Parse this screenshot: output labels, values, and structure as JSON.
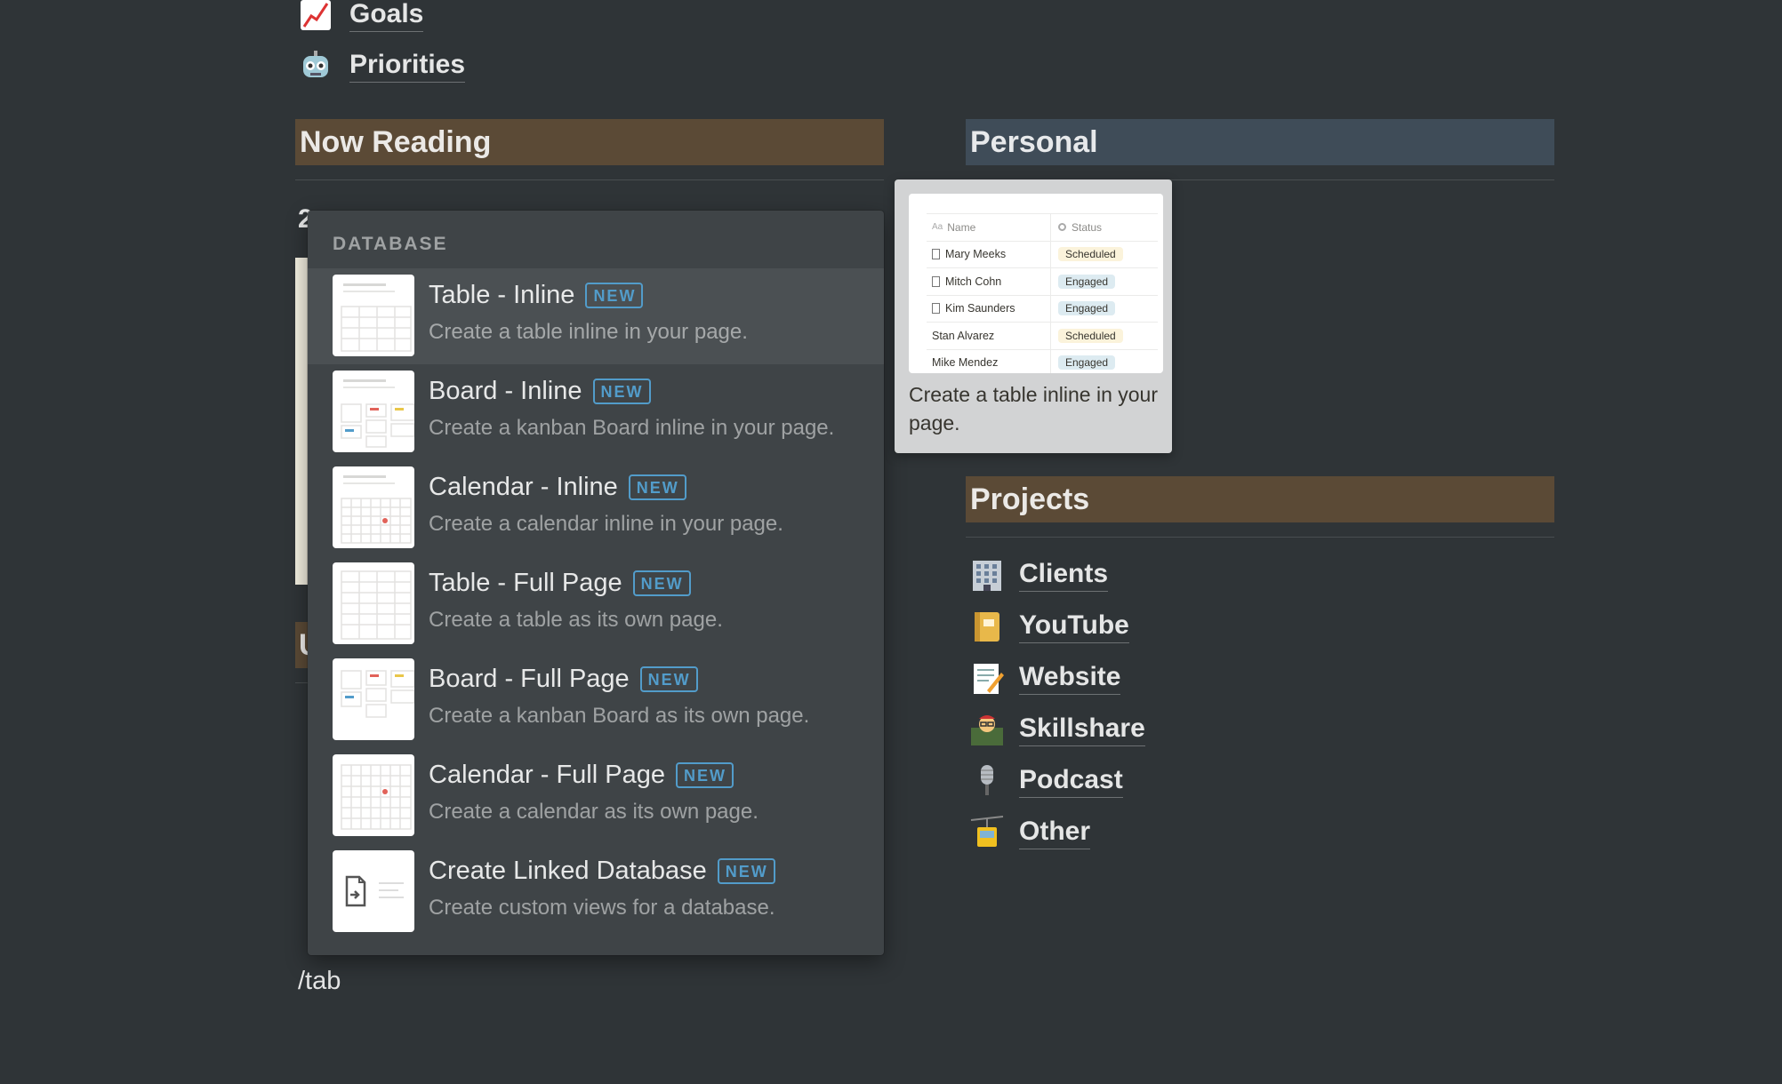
{
  "top_links": [
    {
      "label": "Goals",
      "icon": "chart-increasing-icon"
    },
    {
      "label": "Priorities",
      "icon": "robot-icon"
    }
  ],
  "sections": {
    "now_reading": {
      "title": "Now Reading",
      "color": "#5b4a36"
    },
    "personal": {
      "title": "Personal",
      "color": "#3f4c58"
    },
    "projects": {
      "title": "Projects",
      "color": "#5b4a36"
    }
  },
  "hidden_fragments": {
    "now_reading_first_char": "2",
    "next_header_first_char": "U"
  },
  "menu": {
    "heading": "DATABASE",
    "badge": "NEW",
    "badge_color": "#529cca",
    "items": [
      {
        "title": "Table - Inline",
        "desc": "Create a table inline in your page.",
        "icon": "table-thumbnail"
      },
      {
        "title": "Board - Inline",
        "desc": "Create a kanban Board inline in your page.",
        "icon": "board-thumbnail"
      },
      {
        "title": "Calendar - Inline",
        "desc": "Create a calendar inline in your page.",
        "icon": "calendar-thumbnail"
      },
      {
        "title": "Table - Full Page",
        "desc": "Create a table as its own page.",
        "icon": "table-full-thumbnail"
      },
      {
        "title": "Board - Full Page",
        "desc": "Create a kanban Board as its own page.",
        "icon": "board-full-thumbnail"
      },
      {
        "title": "Calendar - Full Page",
        "desc": "Create a calendar as its own page.",
        "icon": "calendar-full-thumbnail"
      },
      {
        "title": "Create Linked Database",
        "desc": "Create custom views for a database.",
        "icon": "linked-database-thumbnail"
      }
    ]
  },
  "preview": {
    "col_name": "Name",
    "col_status": "Status",
    "rows": [
      {
        "name": "Mary Meeks",
        "status": "Scheduled",
        "has_icon": true
      },
      {
        "name": "Mitch Cohn",
        "status": "Engaged",
        "has_icon": true
      },
      {
        "name": "Kim Saunders",
        "status": "Engaged",
        "has_icon": true
      },
      {
        "name": "Stan Alvarez",
        "status": "Scheduled",
        "has_icon": false
      },
      {
        "name": "Mike Mendez",
        "status": "Engaged",
        "has_icon": false
      }
    ],
    "status_colors": {
      "Scheduled": "#fbf3db",
      "Engaged": "#ddebf1"
    },
    "description": "Create a table inline in your page."
  },
  "projects": [
    {
      "label": "Clients",
      "icon": "office-building-icon"
    },
    {
      "label": "YouTube",
      "icon": "notebook-icon"
    },
    {
      "label": "Website",
      "icon": "memo-icon"
    },
    {
      "label": "Skillshare",
      "icon": "teacher-icon"
    },
    {
      "label": "Podcast",
      "icon": "microphone-icon"
    },
    {
      "label": "Other",
      "icon": "aerial-tramway-icon"
    }
  ],
  "editor": {
    "typed_text": "/tab"
  }
}
